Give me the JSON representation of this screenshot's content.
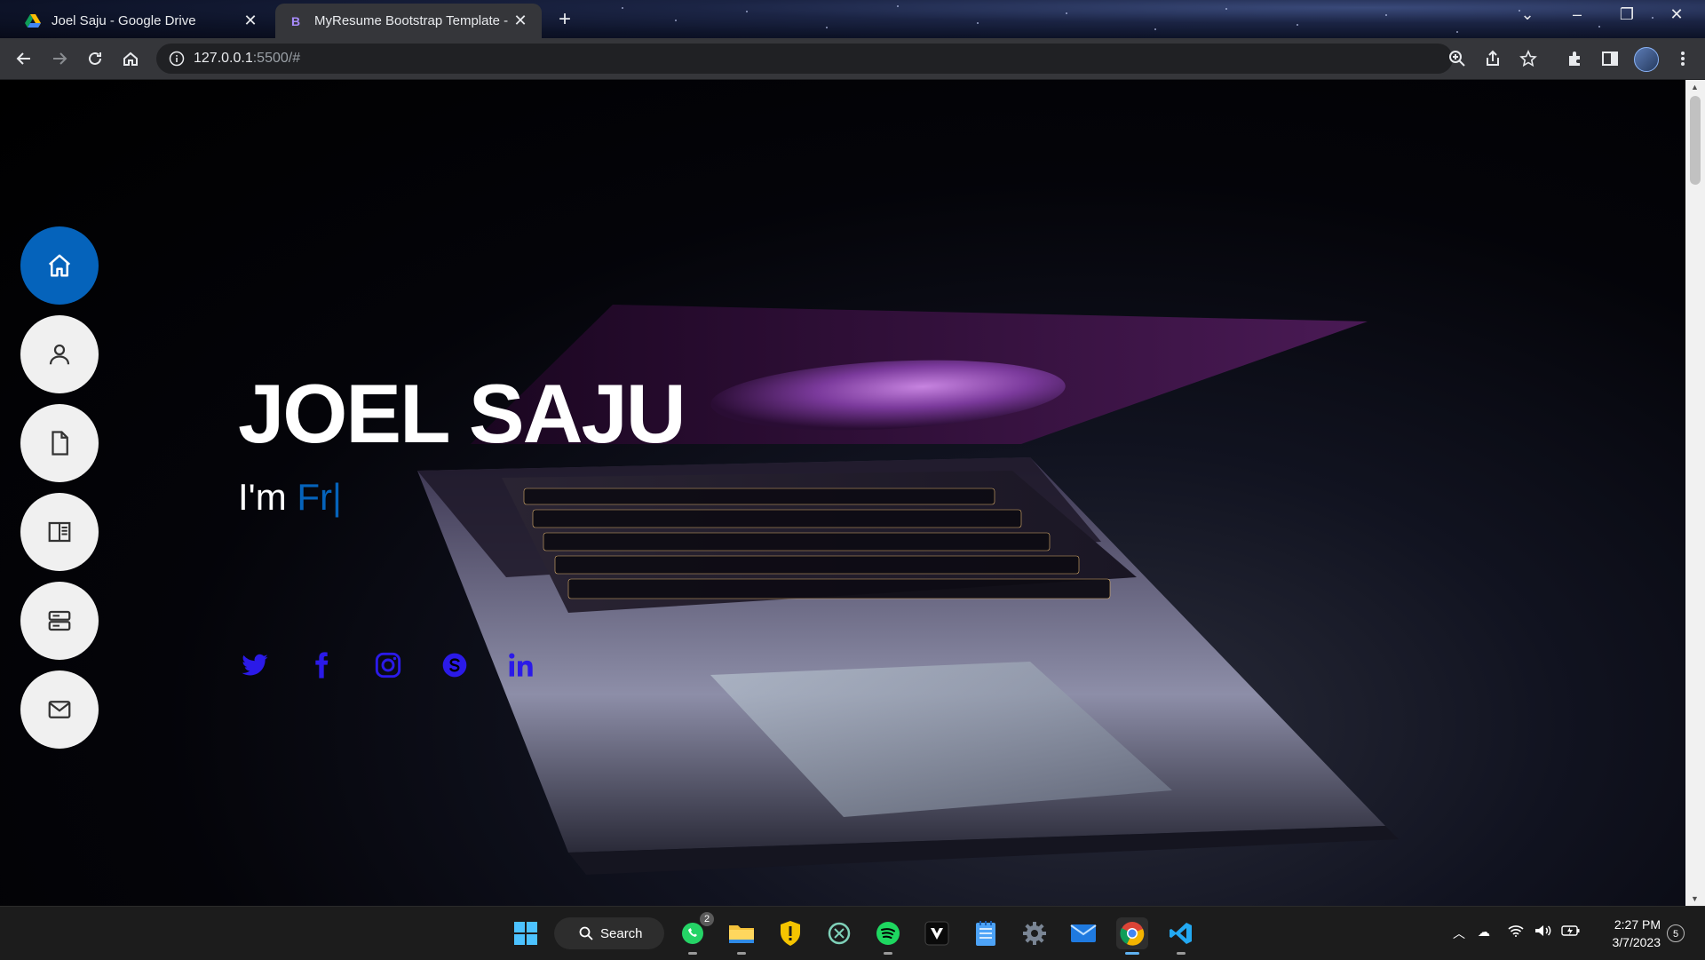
{
  "browser": {
    "tabs": [
      {
        "title": "Joel Saju - Google Drive",
        "icon": "google-drive-icon",
        "active": false
      },
      {
        "title": "MyResume Bootstrap Template -",
        "icon": "bootstrap-icon",
        "favicon_letter": "B",
        "active": true
      }
    ],
    "url": {
      "host": "127.0.0.1",
      "rest": ":5500/#"
    },
    "colors": {
      "chrome_dark": "#35363a",
      "omnibox": "#202124"
    }
  },
  "page": {
    "nav": [
      {
        "name": "home",
        "icon": "home-icon",
        "active": true
      },
      {
        "name": "about",
        "icon": "person-icon",
        "active": false
      },
      {
        "name": "resume",
        "icon": "file-icon",
        "active": false
      },
      {
        "name": "portfolio",
        "icon": "book-icon",
        "active": false
      },
      {
        "name": "services",
        "icon": "server-icon",
        "active": false
      },
      {
        "name": "contact",
        "icon": "envelope-icon",
        "active": false
      }
    ],
    "hero": {
      "title": "JOEL SAJU",
      "subtitle_prefix": "I'm ",
      "typed_text": "Fr",
      "cursor": "|"
    },
    "social": [
      "twitter-icon",
      "facebook-icon",
      "instagram-icon",
      "skype-icon",
      "linkedin-icon"
    ],
    "accent_color": "#0563bb",
    "social_color": "#2b1ae8"
  },
  "taskbar": {
    "search_label": "Search",
    "whatsapp_badge": "2",
    "apps": [
      "windows-start-icon",
      "whatsapp-icon",
      "file-explorer-icon",
      "security-shield-icon",
      "chatgpt-icon",
      "spotify-icon",
      "vivaldi-icon",
      "notepad-icon",
      "settings-icon",
      "mail-icon",
      "chrome-icon",
      "vscode-icon"
    ],
    "time": "2:27 PM",
    "date": "3/7/2023",
    "notifications": "5"
  }
}
